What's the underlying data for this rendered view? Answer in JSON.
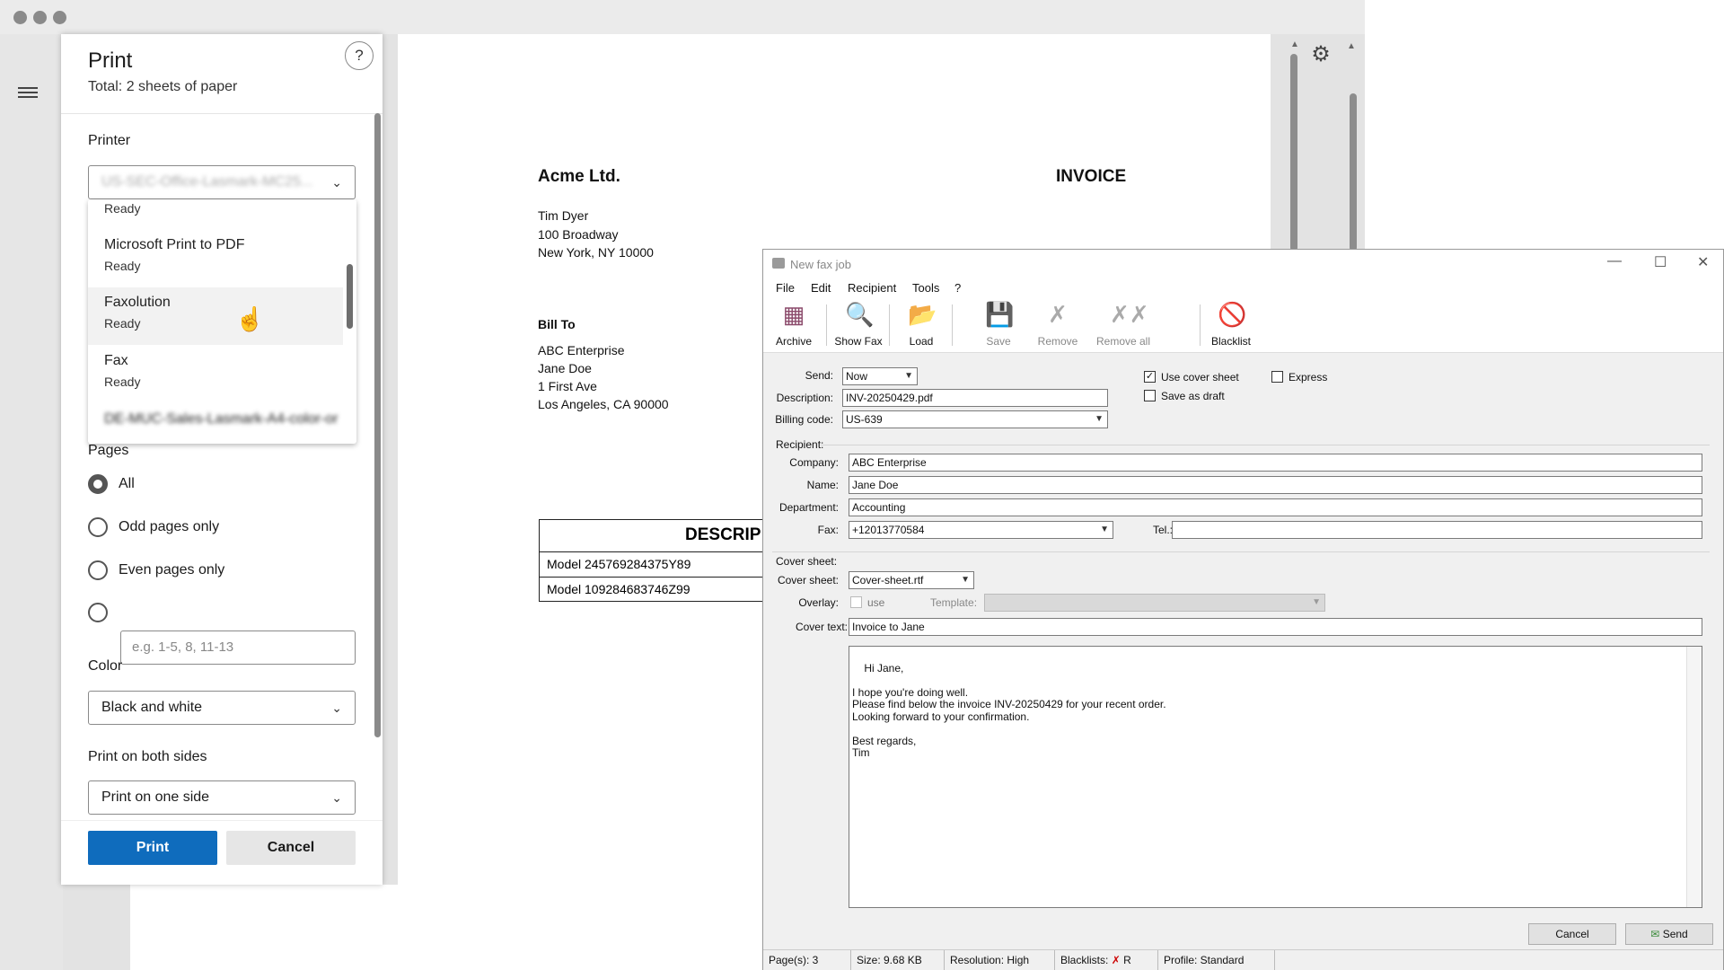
{
  "print": {
    "title": "Print",
    "total": "Total: 2 sheets of paper",
    "help": "?",
    "printer_label": "Printer",
    "printer_selected": "US-SEC-Office-Lasmark-MC25...",
    "printers": [
      {
        "name": "",
        "status": "Ready"
      },
      {
        "name": "Microsoft Print to PDF",
        "status": "Ready"
      },
      {
        "name": "Faxolution",
        "status": "Ready"
      },
      {
        "name": "Fax",
        "status": "Ready"
      },
      {
        "name": "DE-MUC-Sales-Lasmark-A4-color-or",
        "status": ""
      }
    ],
    "pages_label": "Pages",
    "pages_options": [
      "All",
      "Odd pages only",
      "Even pages only"
    ],
    "pages_placeholder": "e.g. 1-5, 8, 11-13",
    "color_label": "Color",
    "color_value": "Black and white",
    "sides_label": "Print on both sides",
    "sides_value": "Print on one side",
    "print_btn": "Print",
    "cancel_btn": "Cancel"
  },
  "invoice": {
    "company": "Acme Ltd.",
    "heading": "INVOICE",
    "sender": [
      "Tim Dyer",
      "100 Broadway",
      "New York, NY 10000"
    ],
    "bill_to_label": "Bill To",
    "bill_to": [
      "ABC Enterprise",
      "Jane Doe",
      "1 First Ave",
      "Los Angeles, CA 90000"
    ],
    "table_header": "DESCRIP",
    "rows": [
      "Model 245769284375Y89",
      "Model 109284683746Z99"
    ]
  },
  "fax": {
    "title": "New fax job",
    "menu": [
      "File",
      "Edit",
      "Recipient",
      "Tools",
      "?"
    ],
    "toolbar": [
      {
        "label": "Archive",
        "icon": "archive-icon",
        "enabled": true
      },
      {
        "label": "Show Fax",
        "icon": "magnifier-icon",
        "enabled": true
      },
      {
        "label": "Load",
        "icon": "load-icon",
        "enabled": true
      },
      {
        "label": "Save",
        "icon": "save-icon",
        "enabled": false
      },
      {
        "label": "Remove",
        "icon": "remove-icon",
        "enabled": false
      },
      {
        "label": "Remove all",
        "icon": "remove-all-icon",
        "enabled": false
      },
      {
        "label": "Blacklist",
        "icon": "blacklist-icon",
        "enabled": true
      }
    ],
    "send_label": "Send:",
    "send_value": "Now",
    "description_label": "Description:",
    "description_value": "INV-20250429.pdf",
    "billing_label": "Billing code:",
    "billing_value": "US-639",
    "use_cover_label": "Use cover sheet",
    "express_label": "Express",
    "draft_label": "Save as draft",
    "recipient_label": "Recipient:",
    "company_label": "Company:",
    "company_value": "ABC Enterprise",
    "name_label": "Name:",
    "name_value": "Jane Doe",
    "department_label": "Department:",
    "department_value": "Accounting",
    "fax_label": "Fax:",
    "fax_value": "+12013770584",
    "tel_label": "Tel.:",
    "tel_value": "",
    "cover_section_label": "Cover sheet:",
    "cover_sheet_label": "Cover sheet:",
    "cover_sheet_value": "Cover-sheet.rtf",
    "overlay_label": "Overlay:",
    "overlay_use": "use",
    "template_label": "Template:",
    "cover_text_label": "Cover text:",
    "cover_text_value": "Invoice to Jane",
    "body": "Hi Jane,\n\nI hope you're doing well.\nPlease find below the invoice INV-20250429 for your recent order.\nLooking forward to your confirmation.\n\nBest regards,\nTim",
    "cancel_btn": "Cancel",
    "send_btn": "Send",
    "status": {
      "pages": "Page(s): 3",
      "size": "Size: 9.68 KB",
      "resolution": "Resolution: High",
      "blacklists": "Blacklists:",
      "blacklist_flag": "R",
      "profile": "Profile: Standard"
    }
  }
}
